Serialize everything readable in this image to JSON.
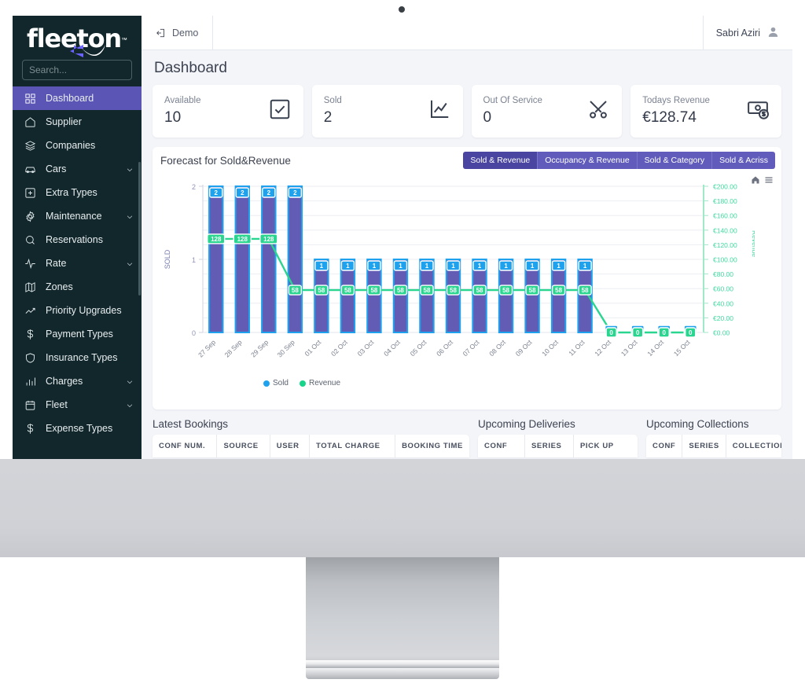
{
  "sidebar": {
    "logo": {
      "text": "fleeton",
      "tm": "™"
    },
    "search": {
      "placeholder": "Search..."
    },
    "items": [
      {
        "label": "Dashboard",
        "icon": "grid-icon",
        "active": true,
        "expandable": false
      },
      {
        "label": "Supplier",
        "icon": "home-icon",
        "active": false,
        "expandable": false
      },
      {
        "label": "Companies",
        "icon": "layers-icon",
        "active": false,
        "expandable": false
      },
      {
        "label": "Cars",
        "icon": "car-icon",
        "active": false,
        "expandable": true
      },
      {
        "label": "Extra Types",
        "icon": "plus-square-icon",
        "active": false,
        "expandable": false
      },
      {
        "label": "Maintenance",
        "icon": "gear-icon",
        "active": false,
        "expandable": true
      },
      {
        "label": "Reservations",
        "icon": "search-icon",
        "active": false,
        "expandable": false
      },
      {
        "label": "Rate",
        "icon": "activity-icon",
        "active": false,
        "expandable": true
      },
      {
        "label": "Zones",
        "icon": "map-icon",
        "active": false,
        "expandable": false
      },
      {
        "label": "Priority Upgrades",
        "icon": "trend-up-icon",
        "active": false,
        "expandable": false
      },
      {
        "label": "Payment Types",
        "icon": "dollar-icon",
        "active": false,
        "expandable": false
      },
      {
        "label": "Insurance Types",
        "icon": "shield-icon",
        "active": false,
        "expandable": false
      },
      {
        "label": "Charges",
        "icon": "bar-chart-icon",
        "active": false,
        "expandable": true
      },
      {
        "label": "Fleet",
        "icon": "calendar-icon",
        "active": false,
        "expandable": true
      },
      {
        "label": "Expense Types",
        "icon": "dollar-icon",
        "active": false,
        "expandable": false
      }
    ]
  },
  "topbar": {
    "tab_label": "Demo",
    "tab_icon": "login-icon",
    "user_name": "Sabri Aziri",
    "user_icon": "avatar-icon"
  },
  "page": {
    "title": "Dashboard"
  },
  "cards": [
    {
      "label": "Available",
      "value": "10",
      "icon": "check-square-icon"
    },
    {
      "label": "Sold",
      "value": "2",
      "icon": "line-chart-icon"
    },
    {
      "label": "Out Of Service",
      "value": "0",
      "icon": "tools-icon"
    },
    {
      "label": "Todays Revenue",
      "value": "€128.74",
      "icon": "money-icon"
    }
  ],
  "chart_panel": {
    "title": "Forecast for Sold&Revenue",
    "tabs": [
      {
        "label": "Sold & Revenue",
        "active": true
      },
      {
        "label": "Occupancy & Revenue",
        "active": false
      },
      {
        "label": "Sold & Category",
        "active": false
      },
      {
        "label": "Sold & Acriss",
        "active": false
      }
    ],
    "tools": [
      "home-icon",
      "menu-icon"
    ]
  },
  "chart_data": {
    "type": "bar",
    "title": "Forecast for Sold&Revenue",
    "xlabel": "",
    "ylabel": "SOLD",
    "y2label": "Revenue",
    "ylim": [
      0,
      2
    ],
    "y_ticks": [
      0,
      1,
      2
    ],
    "y2lim": [
      0,
      200
    ],
    "y2_ticks": [
      0,
      20,
      40,
      60,
      80,
      100,
      120,
      140,
      160,
      180,
      200
    ],
    "y2_tick_labels": [
      "€0.00",
      "€20.00",
      "€40.00",
      "€60.00",
      "€80.00",
      "€100.00",
      "€120.00",
      "€140.00",
      "€160.00",
      "€180.00",
      "€200.00"
    ],
    "grid": true,
    "legend_position": "bottom",
    "categories": [
      "27 Sep",
      "28 Sep",
      "29 Sep",
      "30 Sep",
      "01 Oct",
      "02 Oct",
      "03 Oct",
      "04 Oct",
      "05 Oct",
      "06 Oct",
      "07 Oct",
      "08 Oct",
      "09 Oct",
      "10 Oct",
      "11 Oct",
      "12 Oct",
      "13 Oct",
      "14 Oct",
      "15 Oct"
    ],
    "series": [
      {
        "name": "Sold",
        "type": "bar",
        "color": "#1fa2ee",
        "fill": "#625cb5",
        "axis": "left",
        "values": [
          2,
          2,
          2,
          2,
          1,
          1,
          1,
          1,
          1,
          1,
          1,
          1,
          1,
          1,
          1,
          0,
          0,
          0,
          0
        ]
      },
      {
        "name": "Revenue",
        "type": "line",
        "color": "#2ad68f",
        "axis": "right",
        "values": [
          128,
          128,
          128,
          58,
          58,
          58,
          58,
          58,
          58,
          58,
          58,
          58,
          58,
          58,
          58,
          0,
          0,
          0,
          0
        ]
      }
    ]
  },
  "bottom": {
    "latest_bookings": {
      "title": "Latest Bookings",
      "columns": [
        "CONF NUM.",
        "SOURCE",
        "USER",
        "TOTAL CHARGE",
        "BOOKING TIME"
      ]
    },
    "upcoming_deliveries": {
      "title": "Upcoming Deliveries",
      "columns": [
        "CONF",
        "SERIES",
        "PICK UP"
      ]
    },
    "upcoming_collections": {
      "title": "Upcoming Collections",
      "columns": [
        "CONF",
        "SERIES",
        "COLLECTION"
      ]
    }
  }
}
